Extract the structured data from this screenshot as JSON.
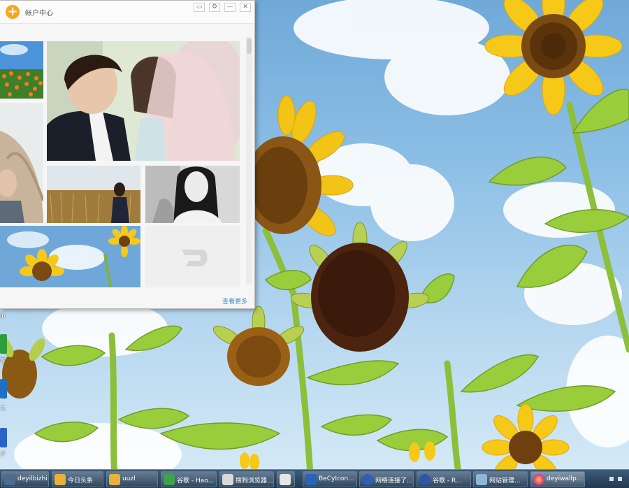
{
  "window": {
    "title": "帐户中心",
    "controls": {
      "menu": "▭",
      "settings": "⚙",
      "minimize": "—",
      "close": "✕"
    },
    "more_link": "查看更多"
  },
  "desktop_icons": [
    {
      "label": "ip"
    },
    {
      "label": "客"
    },
    {
      "label": "之"
    },
    {
      "label": "子"
    }
  ],
  "taskbar": {
    "buttons": [
      {
        "label": "deyilbizhi..."
      },
      {
        "label": "今日头条"
      },
      {
        "label": "uuzl"
      },
      {
        "label": "谷歌 - Hao..."
      },
      {
        "label": "搜狗浏览器..."
      },
      {
        "label": ""
      },
      {
        "label": "BeCyIcon..."
      },
      {
        "label": "网络连接了..."
      },
      {
        "label": "谷歌 - R..."
      },
      {
        "label": "网站管理..."
      },
      {
        "label": "deyiwallp..."
      }
    ]
  },
  "colors": {
    "accent": "#f5a623",
    "link": "#3d8fd1",
    "taskbar": "#2a4561"
  }
}
